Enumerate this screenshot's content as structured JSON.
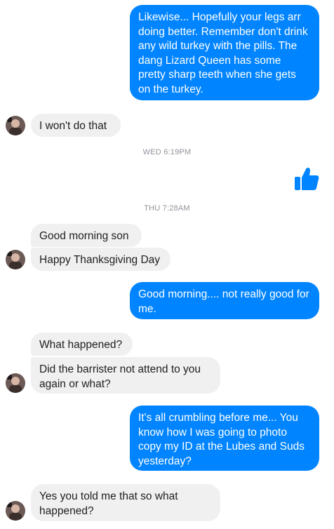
{
  "colors": {
    "outgoing_bg": "#0084ff",
    "incoming_bg": "#f1f0f0",
    "timestamp": "#90949c"
  },
  "messages": {
    "m1": "Likewise... Hopefully your legs arr doing better. Remember don't drink any wild turkey with the pills. The dang Lizard Queen has some pretty sharp teeth when she gets on the turkey.",
    "m2": "I won't do that",
    "m3": "Good morning son",
    "m4": "Happy Thanksgiving Day",
    "m5": "Good morning.... not really good for me.",
    "m6": "What happened?",
    "m7": "Did the barrister not attend to you again or what?",
    "m8": "It's all crumbling before me... You know how I was going to photo copy my ID at the Lubes and Suds yesterday?",
    "m9": "Yes you told me that so what happened?"
  },
  "timestamps": {
    "t1": "WED 6:19PM",
    "t2": "THU 7:28AM"
  },
  "icons": {
    "avatar": "contact-avatar",
    "like": "thumbs-up-icon"
  }
}
